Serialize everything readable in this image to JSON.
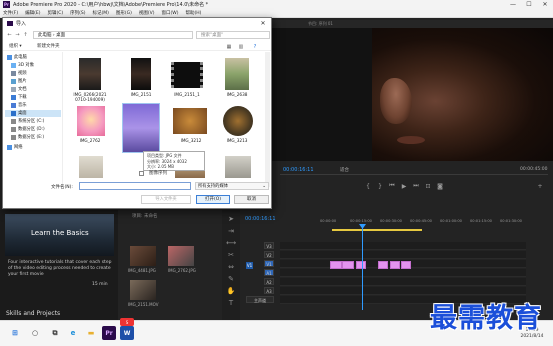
{
  "app": {
    "title": "Adobe Premiere Pro 2020 - C:\\用户\\hbwj\\文档\\Adobe\\Premiere Pro\\14.0\\未命名 *",
    "menu": [
      "文件(F)",
      "编辑(E)",
      "剪辑(C)",
      "序列(S)",
      "标记(M)",
      "图形(G)",
      "视图(V)",
      "窗口(W)",
      "帮助(H)"
    ]
  },
  "program_monitor": {
    "tabs": "节目: 序列 01",
    "timecode_left": "00:00:16:11",
    "fit": "适合",
    "timecode_right": "00:00:45:00"
  },
  "learn": {
    "card_title": "Learn the Basics",
    "description": "Four interactive tutorials that cover each step of the video editing process needed to create your first movie",
    "duration": "15 min",
    "section": "Skills and Projects"
  },
  "project": {
    "tab": "项目: 未命名",
    "items": [
      "IMG_4481.JPG",
      "IMG_2762.JPG",
      "IMG_2151.MOV"
    ]
  },
  "timeline": {
    "timecode": "00:00:16:11",
    "ruler": [
      "00:00:00",
      "00:00:15:00",
      "00:00:30:00",
      "00:00:45:00",
      "00:01:00:00",
      "00:01:15:00",
      "00:01:30:00"
    ],
    "tracks": [
      "V3",
      "V2",
      "V1",
      "A1",
      "A2",
      "A3",
      "主声道"
    ]
  },
  "dialog": {
    "title": "导入",
    "close": "✕",
    "address": "此电脑 › 桌面",
    "search_placeholder": "搜索\"桌面\"",
    "organize": "组织 ▾",
    "new_folder": "新建文件夹",
    "nav": [
      "此电脑",
      "3D 对象",
      "视频",
      "图片",
      "文档",
      "下载",
      "音乐",
      "桌面",
      "系统分区 (C:)",
      "数据分区 (D:)",
      "数据分区 (E:)",
      "网络"
    ],
    "files": [
      {
        "name": "IMG_0266(2021 0710-194009)"
      },
      {
        "name": "IMG_2151"
      },
      {
        "name": "IMG_2151_1"
      },
      {
        "name": "IMG_2638"
      },
      {
        "name": "IMG_2762"
      },
      {
        "name": "IMG_3212"
      },
      {
        "name": "IMG_3213"
      }
    ],
    "tooltip": {
      "line1": "项目类型: JPG 文件",
      "line2": "分辨率: 3024 x 4032",
      "line3": "大小: 2.05 MB"
    },
    "preview_label": "图像序列",
    "filename_label": "文件名(N):",
    "filename_value": "",
    "filter": "所有支持的媒体",
    "import_folder": "导入文件夹",
    "open": "打开(O)",
    "cancel": "取消"
  },
  "taskbar": {
    "time": "17:09",
    "date": "2021/8/14"
  },
  "watermark": "最需教育"
}
